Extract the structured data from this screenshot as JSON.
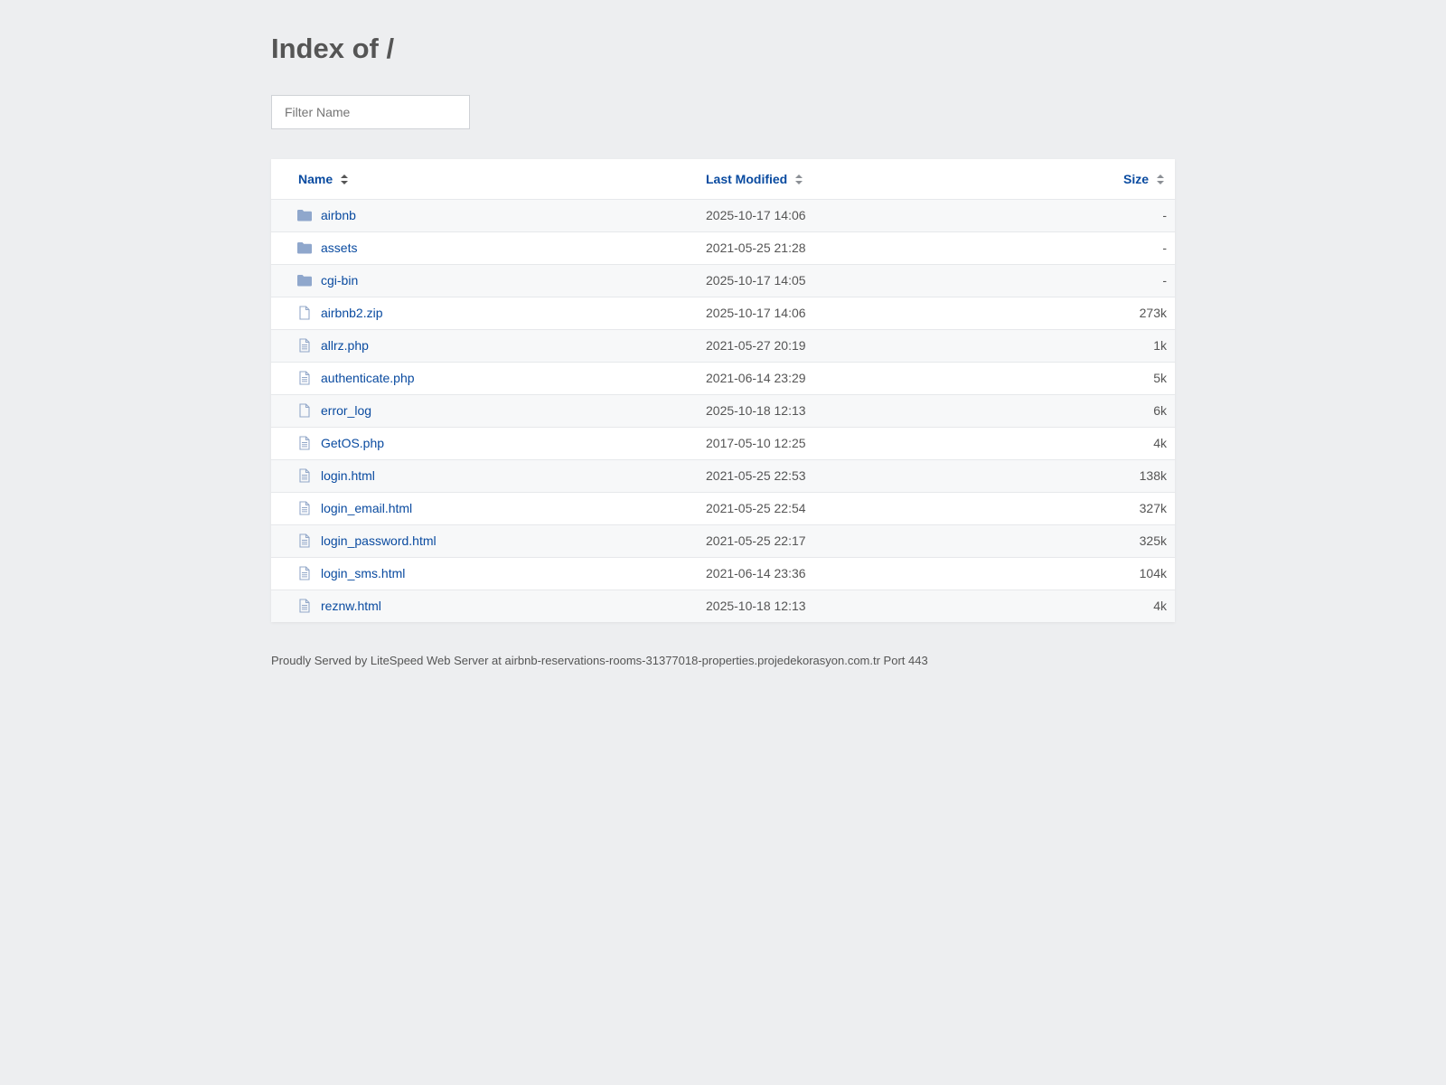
{
  "page": {
    "title": "Index of /",
    "filter_placeholder": "Filter Name",
    "footer": "Proudly Served by LiteSpeed Web Server at airbnb-reservations-rooms-31377018-properties.projedekorasyon.com.tr Port 443"
  },
  "columns": {
    "name": "Name",
    "modified": "Last Modified",
    "size": "Size"
  },
  "colors": {
    "link": "#0a4ba0",
    "folder_icon": "#8fa7cc",
    "file_icon": "#93a8c9",
    "background": "#edeef0"
  },
  "entries": [
    {
      "name": "airbnb",
      "modified": "2025-10-17 14:06",
      "size": "-",
      "icon": "folder-icon"
    },
    {
      "name": "assets",
      "modified": "2021-05-25 21:28",
      "size": "-",
      "icon": "folder-icon"
    },
    {
      "name": "cgi-bin",
      "modified": "2025-10-17 14:05",
      "size": "-",
      "icon": "folder-icon"
    },
    {
      "name": "airbnb2.zip",
      "modified": "2025-10-17 14:06",
      "size": "273k",
      "icon": "file-icon"
    },
    {
      "name": "allrz.php",
      "modified": "2021-05-27 20:19",
      "size": "1k",
      "icon": "document-icon"
    },
    {
      "name": "authenticate.php",
      "modified": "2021-06-14 23:29",
      "size": "5k",
      "icon": "document-icon"
    },
    {
      "name": "error_log",
      "modified": "2025-10-18 12:13",
      "size": "6k",
      "icon": "file-icon"
    },
    {
      "name": "GetOS.php",
      "modified": "2017-05-10 12:25",
      "size": "4k",
      "icon": "document-icon"
    },
    {
      "name": "login.html",
      "modified": "2021-05-25 22:53",
      "size": "138k",
      "icon": "document-icon"
    },
    {
      "name": "login_email.html",
      "modified": "2021-05-25 22:54",
      "size": "327k",
      "icon": "document-icon"
    },
    {
      "name": "login_password.html",
      "modified": "2021-05-25 22:17",
      "size": "325k",
      "icon": "document-icon"
    },
    {
      "name": "login_sms.html",
      "modified": "2021-06-14 23:36",
      "size": "104k",
      "icon": "document-icon"
    },
    {
      "name": "reznw.html",
      "modified": "2025-10-18 12:13",
      "size": "4k",
      "icon": "document-icon"
    }
  ]
}
